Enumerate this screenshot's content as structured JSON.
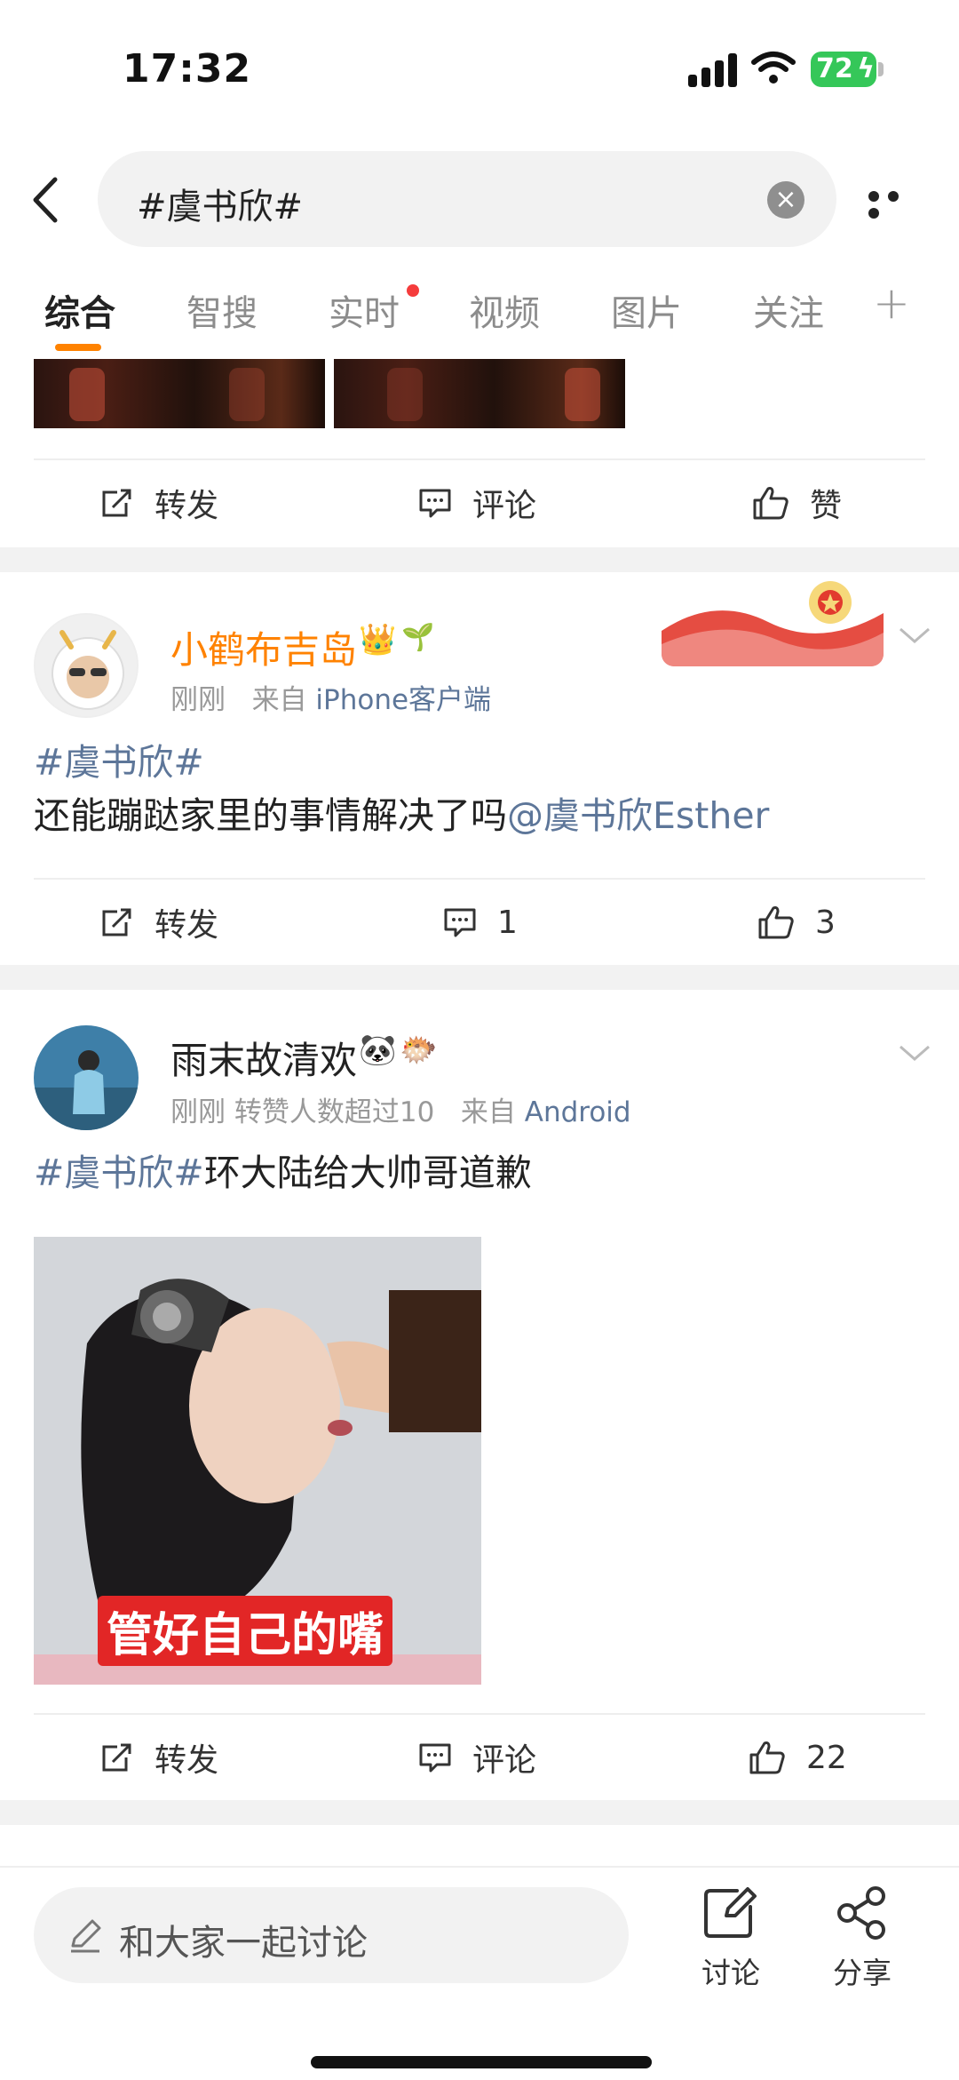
{
  "status_bar": {
    "time": "17:32",
    "battery": "72"
  },
  "header": {
    "search_text": "#虞书欣#",
    "clear_icon": "close-circle-icon"
  },
  "tabs": [
    {
      "label": "综合",
      "active": true
    },
    {
      "label": "智搜",
      "active": false
    },
    {
      "label": "实时",
      "active": false,
      "dot": true
    },
    {
      "label": "视频",
      "active": false
    },
    {
      "label": "图片",
      "active": false
    },
    {
      "label": "关注",
      "active": false
    }
  ],
  "posts": [
    {
      "actions": {
        "repost": "转发",
        "comment": "评论",
        "like": "赞"
      }
    },
    {
      "username": "小鹤布吉岛",
      "username_color": "#ff8200",
      "time": "刚刚",
      "source_prefix": "来自",
      "source": "iPhone客户端",
      "topic": "#虞书欣#",
      "text": "还能蹦跶家里的事情解决了吗",
      "mention": "@虞书欣Esther",
      "actions": {
        "repost": "转发",
        "comment": "1",
        "like": "3"
      }
    },
    {
      "username": "雨末故清欢",
      "time": "刚刚",
      "extra": "转赞人数超过10",
      "source_prefix": "来自",
      "source": "Android",
      "topic": "#虞书欣#",
      "text": "环大陆给大帅哥道歉",
      "image_caption": "管好自己的嘴",
      "actions": {
        "repost": "转发",
        "comment": "评论",
        "like": "22"
      }
    }
  ],
  "bottom_bar": {
    "placeholder": "和大家一起讨论",
    "discuss_label": "讨论",
    "share_label": "分享"
  },
  "colors": {
    "accent": "#ff8200",
    "link": "#5d7699",
    "red_dot": "#f53c3c"
  }
}
